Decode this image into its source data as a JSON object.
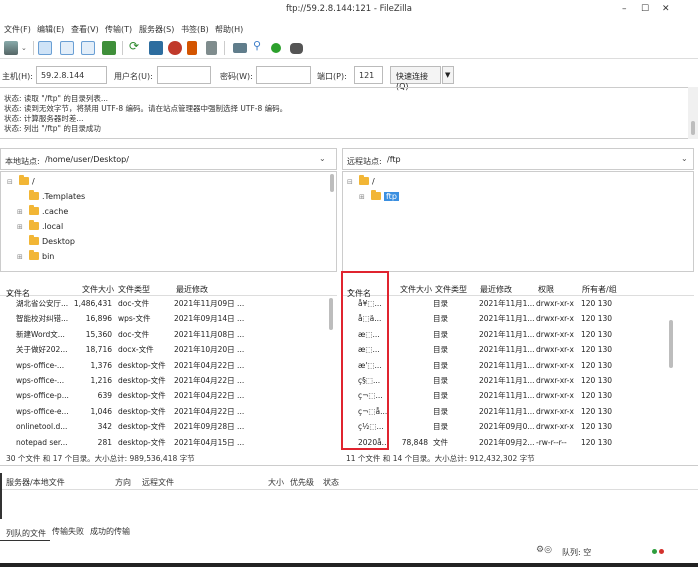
{
  "window": {
    "title": "ftp://59.2.8.144:121 - FileZilla",
    "min_icon": "minimize-icon",
    "max_icon": "maximize-icon",
    "close_icon": "close-icon"
  },
  "menu": [
    "文件(F)",
    "编辑(E)",
    "查看(V)",
    "传输(T)",
    "服务器(S)",
    "书签(B)",
    "帮助(H)"
  ],
  "toolbar": {
    "icons": [
      "site-manager-icon",
      "dropdown-arrow-icon",
      "toggle-log-icon",
      "toggle-local-tree-icon",
      "toggle-remote-tree-icon",
      "toggle-queue-icon",
      "refresh-icon",
      "process-queue-icon",
      "cancel-icon",
      "disconnect-icon",
      "reconnect-icon",
      "filter-icon",
      "compare-icon",
      "sync-browse-icon",
      "find-icon"
    ]
  },
  "connection": {
    "host_label": "主机(H):",
    "host_value": "59.2.8.144",
    "user_label": "用户名(U):",
    "user_value": "",
    "password_label": "密码(W):",
    "password_value": "",
    "port_label": "端口(P):",
    "port_value": "121",
    "quickconnect_label": "快速连接(Q)",
    "dropdown_icon": "dropdown-arrow-icon"
  },
  "log": [
    "状态:  读取 \"/ftp\" 的目录列表...",
    "状态:  读到无效字节，将禁用 UTF-8 编码。请在站点管理器中强制选择 UTF-8 编码。",
    "状态:  计算服务器时差...",
    "状态:  列出 \"/ftp\" 的目录成功"
  ],
  "local": {
    "path_label": "本地站点:",
    "path_value": "/home/user/Desktop/",
    "tree": [
      {
        "label": "/",
        "level": 0,
        "expander": "⊟"
      },
      {
        "label": ".Templates",
        "level": 1,
        "expander": ""
      },
      {
        "label": ".cache",
        "level": 1,
        "expander": "⊞"
      },
      {
        "label": ".local",
        "level": 1,
        "expander": "⊞"
      },
      {
        "label": "Desktop",
        "level": 1,
        "expander": ""
      },
      {
        "label": "bin",
        "level": 1,
        "expander": "⊞"
      }
    ],
    "columns": [
      "文件名",
      "文件大小",
      "文件类型",
      "最近修改"
    ],
    "sort_icon": "sort-desc-icon",
    "files": [
      {
        "name": "湖北省公安厅...",
        "size": "1,486,431",
        "type": "doc-文件",
        "modified": "2021年11月09日 ..."
      },
      {
        "name": "智能校对纠错...",
        "size": "16,896",
        "type": "wps-文件",
        "modified": "2021年09月14日 ..."
      },
      {
        "name": "新建Word文...",
        "size": "15,360",
        "type": "doc-文件",
        "modified": "2021年11月08日 ..."
      },
      {
        "name": "关于做好202...",
        "size": "18,716",
        "type": "docx-文件",
        "modified": "2021年10月20日 ..."
      },
      {
        "name": "wps-office-...",
        "size": "1,376",
        "type": "desktop-文件",
        "modified": "2021年04月22日 ..."
      },
      {
        "name": "wps-office-...",
        "size": "1,216",
        "type": "desktop-文件",
        "modified": "2021年04月22日 ..."
      },
      {
        "name": "wps-office-p...",
        "size": "639",
        "type": "desktop-文件",
        "modified": "2021年04月22日 ..."
      },
      {
        "name": "wps-office-e...",
        "size": "1,046",
        "type": "desktop-文件",
        "modified": "2021年04月22日 ..."
      },
      {
        "name": "onlinetool.d...",
        "size": "342",
        "type": "desktop-文件",
        "modified": "2021年09月28日 ..."
      },
      {
        "name": "notepad ser...",
        "size": "281",
        "type": "desktop-文件",
        "modified": "2021年04月15日 ..."
      }
    ],
    "status": "30 个文件 和 17 个目录。大小总计: 989,536,418 字节"
  },
  "remote": {
    "path_label": "远程站点:",
    "path_value": "/ftp",
    "tree": [
      {
        "label": "/",
        "level": 0,
        "expander": "⊟"
      },
      {
        "label": "ftp",
        "level": 1,
        "expander": "⊞",
        "selected": true
      }
    ],
    "columns": [
      "文件名",
      "文件大小",
      "文件类型",
      "最近修改",
      "权限",
      "所有者/组"
    ],
    "sort_icon": "sort-asc-icon",
    "files": [
      {
        "name": "å¥⬚...",
        "size": "",
        "type": "目录",
        "modified": "2021年11月1...",
        "perm": "drwxr-xr-x",
        "owner": "120 130",
        "icon": "folder"
      },
      {
        "name": "å⬚ä...",
        "size": "",
        "type": "目录",
        "modified": "2021年11月1...",
        "perm": "drwxr-xr-x",
        "owner": "120 130",
        "icon": "folder"
      },
      {
        "name": "æ⬚...",
        "size": "",
        "type": "目录",
        "modified": "2021年11月1...",
        "perm": "drwxr-xr-x",
        "owner": "120 130",
        "icon": "folder"
      },
      {
        "name": "æ⬚...",
        "size": "",
        "type": "目录",
        "modified": "2021年11月1...",
        "perm": "drwxr-xr-x",
        "owner": "120 130",
        "icon": "folder"
      },
      {
        "name": "æ'⬚...",
        "size": "",
        "type": "目录",
        "modified": "2021年11月1...",
        "perm": "drwxr-xr-x",
        "owner": "120 130",
        "icon": "folder"
      },
      {
        "name": "ç§⬚...",
        "size": "",
        "type": "目录",
        "modified": "2021年11月1...",
        "perm": "drwxr-xr-x",
        "owner": "120 130",
        "icon": "folder"
      },
      {
        "name": "ç¬⬚...",
        "size": "",
        "type": "目录",
        "modified": "2021年11月1...",
        "perm": "drwxr-xr-x",
        "owner": "120 130",
        "icon": "folder"
      },
      {
        "name": "ç¬⬚å...",
        "size": "",
        "type": "目录",
        "modified": "2021年11月1...",
        "perm": "drwxr-xr-x",
        "owner": "120 130",
        "icon": "folder"
      },
      {
        "name": "ç½⬚...",
        "size": "",
        "type": "目录",
        "modified": "2021年09月0...",
        "perm": "drwxr-xr-x",
        "owner": "120 130",
        "icon": "folder"
      },
      {
        "name": "2020å...",
        "size": "78,848",
        "type": "文件",
        "modified": "2021年09月2...",
        "perm": "-rw-r--r--",
        "owner": "120 130",
        "icon": "file"
      }
    ],
    "status": "11 个文件 和 14 个目录。大小总计: 912,432,302 字节"
  },
  "queue": {
    "columns": [
      "服务器/本地文件",
      "方向",
      "远程文件",
      "大小",
      "优先级",
      "状态"
    ],
    "tabs": [
      "列队的文件",
      "传输失败",
      "成功的传输"
    ],
    "status": "队列: 空",
    "gear_icon": "settings-gear-icon"
  }
}
